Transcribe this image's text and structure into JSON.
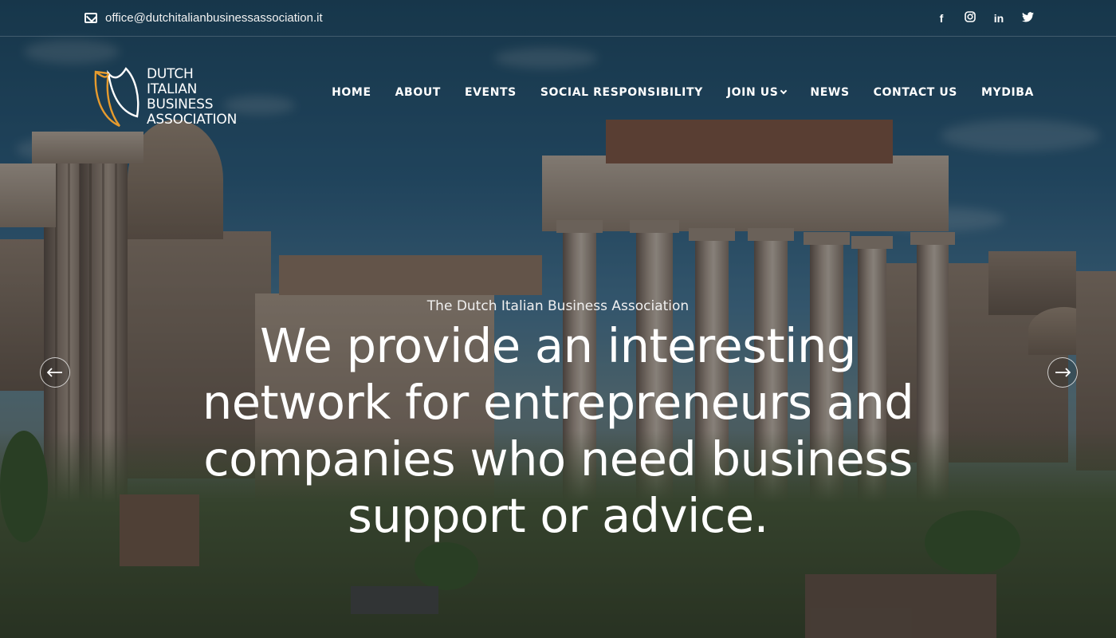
{
  "topbar": {
    "email": "office@dutchitalianbusinessassociation.it",
    "social": {
      "facebook": "f",
      "instagram": "◎",
      "linkedin": "in",
      "twitter": "🐦"
    }
  },
  "logo": {
    "line1": "DUTCH",
    "line2": "ITALIAN",
    "line3": "BUSINESS",
    "line4": "ASSOCIATION"
  },
  "nav": {
    "home": "HOME",
    "about": "ABOUT",
    "events": "EVENTS",
    "social_responsibility": "SOCIAL RESPONSIBILITY",
    "join_us": "JOIN US",
    "news": "NEWS",
    "contact_us": "CONTACT US",
    "mydiba": "MYDIBA"
  },
  "hero": {
    "kicker": "The Dutch Italian Business Association",
    "headline": "We provide an interesting network for entrepreneurs and companies who need business support or advice."
  },
  "colors": {
    "logo_orange": "#e69b2e",
    "logo_white": "#ffffff"
  },
  "icons": {
    "email": "envelope-icon",
    "prev": "arrow-left-icon",
    "next": "arrow-right-icon",
    "dropdown": "chevron-down-icon"
  }
}
